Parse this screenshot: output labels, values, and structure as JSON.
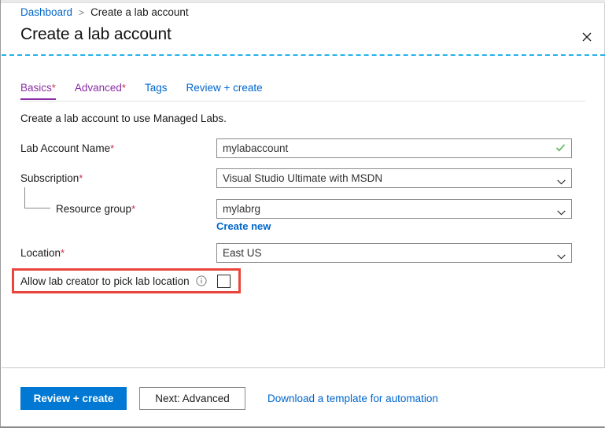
{
  "breadcrumb": {
    "root": "Dashboard",
    "separator": ">",
    "current": "Create a lab account"
  },
  "header": {
    "title": "Create a lab account",
    "close_icon": "close-icon",
    "accent_dash_color": "#25b3ec"
  },
  "tabs": [
    {
      "label": "Basics",
      "required_marker": "*",
      "active": true,
      "color": "#8c2fa6"
    },
    {
      "label": "Advanced",
      "required_marker": "*",
      "active": false,
      "color": "#8c2fa6"
    },
    {
      "label": "Tags",
      "required_marker": "",
      "active": false,
      "color": "#0066cc"
    },
    {
      "label": "Review + create",
      "required_marker": "",
      "active": false,
      "color": "#0066cc"
    }
  ],
  "description": "Create a lab account to use Managed Labs.",
  "form": {
    "required_star": "*",
    "fields": [
      {
        "label": "Lab Account Name",
        "required_marker": "*",
        "type": "textbox",
        "value": "mylabaccount",
        "placeholder": "",
        "validation_icon": "checkmark-icon",
        "validation_color": "#5ab75a"
      },
      {
        "label": "Subscription",
        "required_marker": "*",
        "type": "dropdown",
        "value": "Visual Studio Ultimate with MSDN",
        "dropdown_icon": "chevron-down-icon"
      },
      {
        "label": "Resource group",
        "required_marker": "*",
        "type": "dropdown",
        "value": "mylabrg",
        "dropdown_icon": "chevron-down-icon",
        "nested": true,
        "sub_link": "Create new"
      },
      {
        "label": "Location",
        "required_marker": "*",
        "type": "dropdown",
        "value": "East US",
        "dropdown_icon": "chevron-down-icon"
      }
    ],
    "checkbox_row": {
      "label": "Allow lab creator to pick lab location",
      "info_icon": "info-icon",
      "checked": false,
      "highlighted": true,
      "highlight_color": "#e8453c"
    }
  },
  "footer": {
    "primary_button": "Review + create",
    "secondary_button": "Next: Advanced",
    "template_link": "Download a template for automation",
    "primary_color": "#0078d4",
    "link_color": "#0066cc"
  }
}
